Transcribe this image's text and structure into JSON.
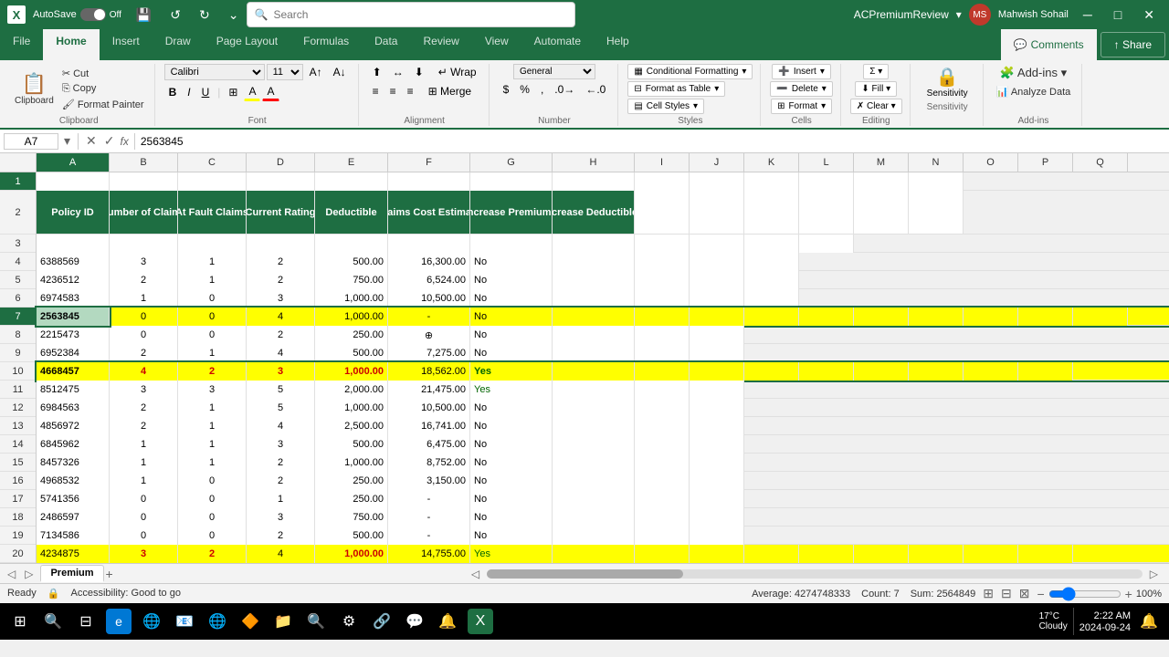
{
  "titleBar": {
    "appIcon": "X",
    "autoSave": "AutoSave",
    "toggleState": "off",
    "fileName": "ACPremiumReview",
    "dropdownArrow": "▾",
    "undoIcon": "↺",
    "redoIcon": "↻",
    "searchPlaceholder": "Search",
    "userName": "Mahwish Sohail",
    "minimizeIcon": "─",
    "restoreIcon": "□",
    "closeIcon": "✕"
  },
  "tabs": [
    {
      "label": "File",
      "active": false
    },
    {
      "label": "Home",
      "active": true
    },
    {
      "label": "Insert",
      "active": false
    },
    {
      "label": "Draw",
      "active": false
    },
    {
      "label": "Page Layout",
      "active": false
    },
    {
      "label": "Formulas",
      "active": false
    },
    {
      "label": "Data",
      "active": false
    },
    {
      "label": "Review",
      "active": false
    },
    {
      "label": "View",
      "active": false
    },
    {
      "label": "Automate",
      "active": false
    },
    {
      "label": "Help",
      "active": false
    }
  ],
  "ribbon": {
    "clipboardLabel": "Clipboard",
    "fontLabel": "Font",
    "alignmentLabel": "Alignment",
    "numberLabel": "Number",
    "stylesLabel": "Styles",
    "cellsLabel": "Cells",
    "editingLabel": "Editing",
    "sensitivityLabel": "Sensitivity",
    "addInsLabel": "Add-ins",
    "fontName": "Calibri",
    "fontSize": "11",
    "boldLabel": "B",
    "italicLabel": "I",
    "underlineLabel": "U",
    "numberFormat": "General",
    "conditionalFormatting": "Conditional Formatting",
    "formatAsTable": "Format as Table",
    "cellStyles": "Cell Styles",
    "formatLabel": "Format",
    "insertLabel": "Insert",
    "deleteLabel": "Delete"
  },
  "formulaBar": {
    "cellRef": "A7",
    "fxLabel": "fx",
    "formula": "2563845"
  },
  "columnHeaders": [
    "A",
    "B",
    "C",
    "D",
    "E",
    "F",
    "G",
    "H",
    "I",
    "J",
    "K",
    "L",
    "M",
    "N",
    "O",
    "P",
    "Q"
  ],
  "rowHeaders": [
    "1",
    "2",
    "3",
    "4",
    "5",
    "6",
    "7",
    "8",
    "9",
    "10",
    "11",
    "12",
    "13",
    "14",
    "15",
    "16",
    "17",
    "18",
    "19",
    "20"
  ],
  "headerRow": {
    "colA": "Policy ID",
    "colB": "Number of Claims",
    "colC": "At Fault Claims",
    "colD": "Current Rating",
    "colE": "Deductible",
    "colF": "Claims Cost Estimate",
    "colG": "Increase Premium?",
    "colH": "Increase Deductible?"
  },
  "rows": [
    {
      "rowNum": "3",
      "a": "",
      "b": "",
      "c": "",
      "d": "",
      "e": "",
      "f": "",
      "g": "",
      "h": "",
      "highlight": "none"
    },
    {
      "rowNum": "4",
      "a": "6388569",
      "b": "3",
      "c": "1",
      "d": "2",
      "e": "500.00",
      "f": "16,300.00",
      "g": "No",
      "h": "",
      "highlight": "none"
    },
    {
      "rowNum": "5",
      "a": "4236512",
      "b": "2",
      "c": "1",
      "d": "2",
      "e": "750.00",
      "f": "6,524.00",
      "g": "No",
      "h": "",
      "highlight": "none"
    },
    {
      "rowNum": "6",
      "a": "6974583",
      "b": "1",
      "c": "0",
      "d": "3",
      "e": "1,000.00",
      "f": "10,500.00",
      "g": "No",
      "h": "",
      "highlight": "none"
    },
    {
      "rowNum": "7",
      "a": "2563845",
      "b": "0",
      "c": "0",
      "d": "4",
      "e": "1,000.00",
      "f": "-",
      "g": "No",
      "h": "",
      "highlight": "yellow"
    },
    {
      "rowNum": "8",
      "a": "2215473",
      "b": "0",
      "c": "0",
      "d": "2",
      "e": "250.00",
      "f": "",
      "g": "No",
      "h": "",
      "highlight": "none"
    },
    {
      "rowNum": "9",
      "a": "6952384",
      "b": "2",
      "c": "1",
      "d": "4",
      "e": "500.00",
      "f": "7,275.00",
      "g": "No",
      "h": "",
      "highlight": "none"
    },
    {
      "rowNum": "10",
      "a": "4668457",
      "b": "4",
      "c": "2",
      "d": "3",
      "e": "1,000.00",
      "f": "18,562.00",
      "g": "Yes",
      "h": "",
      "highlight": "yellow"
    },
    {
      "rowNum": "11",
      "a": "8512475",
      "b": "3",
      "c": "3",
      "d": "5",
      "e": "2,000.00",
      "f": "21,475.00",
      "g": "Yes",
      "h": "",
      "highlight": "none"
    },
    {
      "rowNum": "12",
      "a": "6984563",
      "b": "2",
      "c": "1",
      "d": "5",
      "e": "1,000.00",
      "f": "10,500.00",
      "g": "No",
      "h": "",
      "highlight": "none"
    },
    {
      "rowNum": "13",
      "a": "4856972",
      "b": "2",
      "c": "1",
      "d": "4",
      "e": "2,500.00",
      "f": "16,741.00",
      "g": "No",
      "h": "",
      "highlight": "none"
    },
    {
      "rowNum": "14",
      "a": "6845962",
      "b": "1",
      "c": "1",
      "d": "3",
      "e": "500.00",
      "f": "6,475.00",
      "g": "No",
      "h": "",
      "highlight": "none"
    },
    {
      "rowNum": "15",
      "a": "8457326",
      "b": "1",
      "c": "1",
      "d": "2",
      "e": "1,000.00",
      "f": "8,752.00",
      "g": "No",
      "h": "",
      "highlight": "none"
    },
    {
      "rowNum": "16",
      "a": "4968532",
      "b": "1",
      "c": "0",
      "d": "2",
      "e": "250.00",
      "f": "3,150.00",
      "g": "No",
      "h": "",
      "highlight": "none"
    },
    {
      "rowNum": "17",
      "a": "5741356",
      "b": "0",
      "c": "0",
      "d": "1",
      "e": "250.00",
      "f": "-",
      "g": "No",
      "h": "",
      "highlight": "none"
    },
    {
      "rowNum": "18",
      "a": "2486597",
      "b": "0",
      "c": "0",
      "d": "3",
      "e": "750.00",
      "f": "-",
      "g": "No",
      "h": "",
      "highlight": "none"
    },
    {
      "rowNum": "19",
      "a": "7134586",
      "b": "0",
      "c": "0",
      "d": "2",
      "e": "500.00",
      "f": "-",
      "g": "No",
      "h": "",
      "highlight": "none"
    },
    {
      "rowNum": "20",
      "a": "4234875",
      "b": "3",
      "c": "2",
      "d": "4",
      "e": "1,000.00",
      "f": "14,755.00",
      "g": "Yes",
      "h": "",
      "highlight": "yellow"
    }
  ],
  "sheetTabs": {
    "premium": "Premium",
    "addIcon": "+"
  },
  "statusBar": {
    "ready": "Ready",
    "accessibility": "Accessibility: Good to go",
    "average": "Average: 4274748333",
    "count": "Count: 7",
    "sum": "Sum: 2564849",
    "zoom": "100%"
  },
  "taskbar": {
    "weather": "17°C",
    "condition": "Cloudy",
    "time": "2:22 AM",
    "date": "2024-09-24"
  }
}
